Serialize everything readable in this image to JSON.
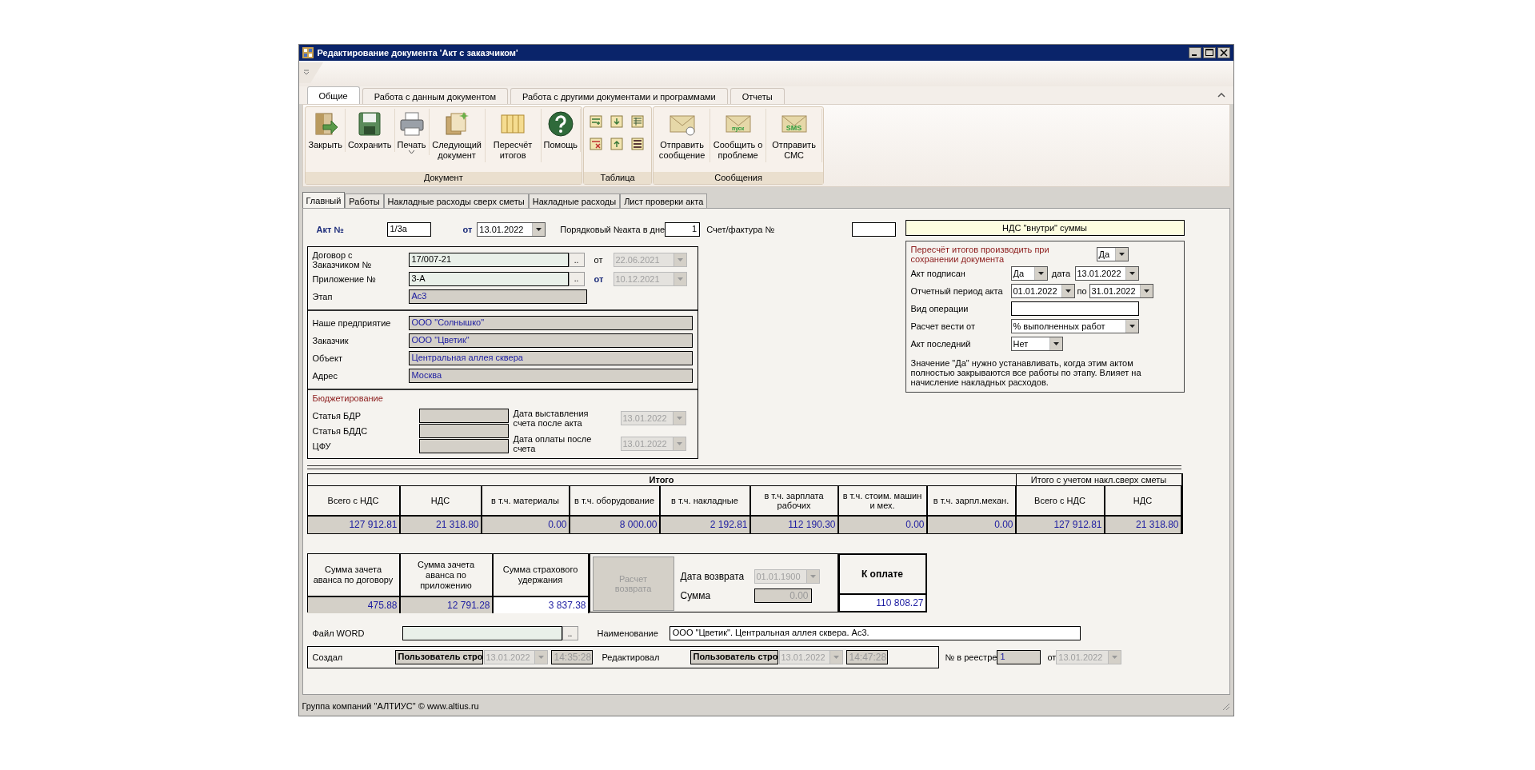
{
  "window": {
    "title": "Редактирование документа 'Акт с заказчиком'"
  },
  "ribbon": {
    "tabs": [
      {
        "label": "Общие",
        "selected": true
      },
      {
        "label": "Работа с данным документом",
        "selected": false
      },
      {
        "label": "Работа с другими документами и программами",
        "selected": false
      },
      {
        "label": "Отчеты",
        "selected": false
      }
    ],
    "groups": [
      {
        "label": "Документ",
        "buttons": [
          {
            "kind": "close",
            "label": "Закрыть",
            "dropdown": false
          },
          {
            "kind": "save",
            "label": "Сохранить",
            "dropdown": false
          },
          {
            "kind": "print",
            "label": "Печать",
            "dropdown": true
          },
          {
            "kind": "next",
            "label": "Следующий документ",
            "dropdown": false
          },
          {
            "kind": "recalc",
            "label": "Пересчёт итогов",
            "dropdown": false
          },
          {
            "kind": "help",
            "label": "Помощь",
            "dropdown": false
          }
        ]
      },
      {
        "label": "Таблица",
        "tools": [
          {
            "kind": "add-row"
          },
          {
            "kind": "move-down"
          },
          {
            "kind": "table-settings"
          },
          {
            "kind": "delete-row"
          },
          {
            "kind": "move-up"
          },
          {
            "kind": "list"
          }
        ]
      },
      {
        "label": "Сообщения",
        "buttons": [
          {
            "kind": "mail",
            "label": "Отправить сообщение",
            "dropdown": false
          },
          {
            "kind": "problem",
            "label": "Сообщить о проблеме",
            "badge": "пуск",
            "dropdown": false
          },
          {
            "kind": "sms",
            "label": "Отправить СМС",
            "badge": "SMS",
            "dropdown": false
          }
        ]
      }
    ]
  },
  "doc_tabs": [
    {
      "label": "Главный",
      "selected": true
    },
    {
      "label": "Работы",
      "selected": false
    },
    {
      "label": "Накладные расходы сверх сметы",
      "selected": false
    },
    {
      "label": "Накладные расходы",
      "selected": false
    },
    {
      "label": "Лист проверки акта",
      "selected": false
    }
  ],
  "header": {
    "act_label": "Акт №",
    "act_number": "1/3а",
    "from_label": "от",
    "act_date": {
      "value": "13.01.2022",
      "disabled": false
    },
    "seq_label": "Порядковый №акта в дне",
    "seq_value": "1",
    "invoice_label": "Счет/фактура №"
  },
  "contract": [
    {
      "kind": "lookup",
      "label": "Договор с Заказчиком №",
      "value": "17/007-21",
      "browse": "..",
      "from_label": "от",
      "from_emphasis": false,
      "date": {
        "value": "22.06.2021",
        "disabled": true
      }
    },
    {
      "kind": "lookup",
      "label": "Приложение №",
      "value": "3-А",
      "browse": "..",
      "from_label": "от",
      "from_emphasis": true,
      "date": {
        "value": "10.12.2021",
        "disabled": true
      }
    },
    {
      "kind": "readonly",
      "label": "Этап",
      "value": "Ас3"
    }
  ],
  "parties": [
    {
      "label": "Наше предприятие",
      "value": "ООО \"Солнышко\""
    },
    {
      "label": "Заказчик",
      "value": "ООО \"Цветик\""
    },
    {
      "label": "Объект",
      "value": "Центральная аллея сквера"
    },
    {
      "label": "Адрес",
      "value": "Москва"
    }
  ],
  "budget": {
    "title": "Бюджетирование",
    "items": [
      {
        "label": "Статья БДР"
      },
      {
        "label": "Статья БДДС"
      },
      {
        "label": "ЦФУ"
      }
    ],
    "dates": [
      {
        "label": "Дата выставления счета после акта",
        "date": {
          "value": "13.01.2022",
          "disabled": true
        }
      },
      {
        "label": "Дата оплаты после счета",
        "date": {
          "value": "13.01.2022",
          "disabled": true
        }
      }
    ]
  },
  "vat_mode": "НДС \"внутри\" суммы",
  "options": {
    "recalc": {
      "label": "Пересчёт итогов производить при сохранении документа",
      "value": {
        "value": "Да",
        "disabled": false
      }
    },
    "signed": {
      "label": "Акт подписан",
      "value": {
        "value": "Да",
        "disabled": false
      },
      "date_label": "дата",
      "date": {
        "value": "13.01.2022",
        "disabled": false
      }
    },
    "period": {
      "label": "Отчетный период акта",
      "from": {
        "value": "01.01.2022",
        "disabled": false
      },
      "to_label": "по",
      "to": {
        "value": "31.01.2022",
        "disabled": false
      }
    },
    "operation": {
      "label": "Вид операции"
    },
    "calc_from": {
      "label": "Расчет вести от",
      "value": {
        "value": "% выполненных работ",
        "disabled": false
      }
    },
    "last": {
      "label": "Акт последний",
      "value": {
        "value": "Нет",
        "disabled": false
      }
    },
    "note": "Значение \"Да\" нужно устанавливать, когда этим актом полностью закрываются все работы по этапу. Влияет на начисление накладных расходов."
  },
  "totals": [
    {
      "label": "Итого",
      "columns": [
        {
          "label": "Всего с НДС",
          "value": "127 912.81"
        },
        {
          "label": "НДС",
          "value": "21 318.80"
        },
        {
          "label": "в т.ч. материалы",
          "value": "0.00"
        },
        {
          "label": "в т.ч. оборудование",
          "value": "8 000.00"
        },
        {
          "label": "в т.ч. накладные",
          "value": "2 192.81"
        },
        {
          "label": "в т.ч. зарплата рабочих",
          "value": "112 190.30"
        },
        {
          "label": "в т.ч. стоим. машин и мех.",
          "value": "0.00"
        },
        {
          "label": "в т.ч. зарпл.механ.",
          "value": "0.00"
        }
      ]
    },
    {
      "label": "Итого с учетом накл.сверх сметы",
      "columns": [
        {
          "label": "Всего с НДС",
          "value": "127 912.81"
        },
        {
          "label": "НДС",
          "value": "21 318.80"
        }
      ]
    }
  ],
  "advances": [
    {
      "label": "Сумма зачета аванса по договору",
      "value": "475.88",
      "kind": "readonly"
    },
    {
      "label": "Сумма зачета аванса по приложению",
      "value": "12 791.28",
      "kind": "readonly"
    },
    {
      "label": "Сумма страхового удержания",
      "value": "3 837.38",
      "kind": "editable"
    }
  ],
  "refund": {
    "button": "Расчет возврата",
    "disabled": true,
    "date_label": "Дата возврата",
    "date": {
      "value": "01.01.1900",
      "disabled": true
    },
    "sum_label": "Сумма",
    "sum": "0.00"
  },
  "to_pay": {
    "label": "К оплате",
    "value": "110 808.27"
  },
  "file": {
    "label": "Файл WORD",
    "browse": "..",
    "name_label": "Наименование",
    "name": "ООО \"Цветик\". Центральная аллея сквера. Ас3."
  },
  "audit": {
    "created_label": "Создал",
    "created_by": "Пользователь стро",
    "created_date": {
      "value": "13.01.2022",
      "disabled": true
    },
    "created_time": "14:35:28",
    "edited_label": "Редактировал",
    "edited_by": "Пользователь стро",
    "edited_date": {
      "value": "13.01.2022",
      "disabled": true
    },
    "edited_time": "14:47:28"
  },
  "registry": {
    "label": "№ в реестре",
    "value": "1",
    "from_label": "от",
    "date": {
      "value": "13.01.2022",
      "disabled": true
    }
  },
  "status_bar": {
    "text": "Группа компаний \"АЛТИУС\" © www.altius.ru"
  }
}
